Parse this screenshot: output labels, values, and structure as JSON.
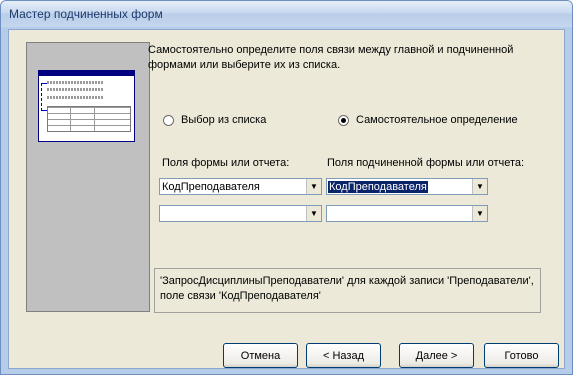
{
  "window": {
    "title": "Мастер подчиненных форм"
  },
  "instructions": "Самостоятельно определите поля связи между главной и подчиненной формами или выберите их из списка.",
  "options": {
    "from_list": {
      "label": "Выбор из списка",
      "selected": false
    },
    "define_own": {
      "label": "Самостоятельное определение",
      "selected": true
    }
  },
  "fields": {
    "main_label": "Поля формы или отчета:",
    "sub_label": "Поля подчиненной формы или отчета:",
    "main_rows": [
      "КодПреподавателя",
      ""
    ],
    "sub_rows": [
      "КодПреподавателя",
      ""
    ]
  },
  "summary": "'ЗапросДисциплиныПреподаватели' для каждой записи 'Преподаватели', поле связи 'КодПреподавателя'",
  "buttons": {
    "cancel": "Отмена",
    "back": "< Назад",
    "next": "Далее >",
    "finish": "Готово"
  }
}
